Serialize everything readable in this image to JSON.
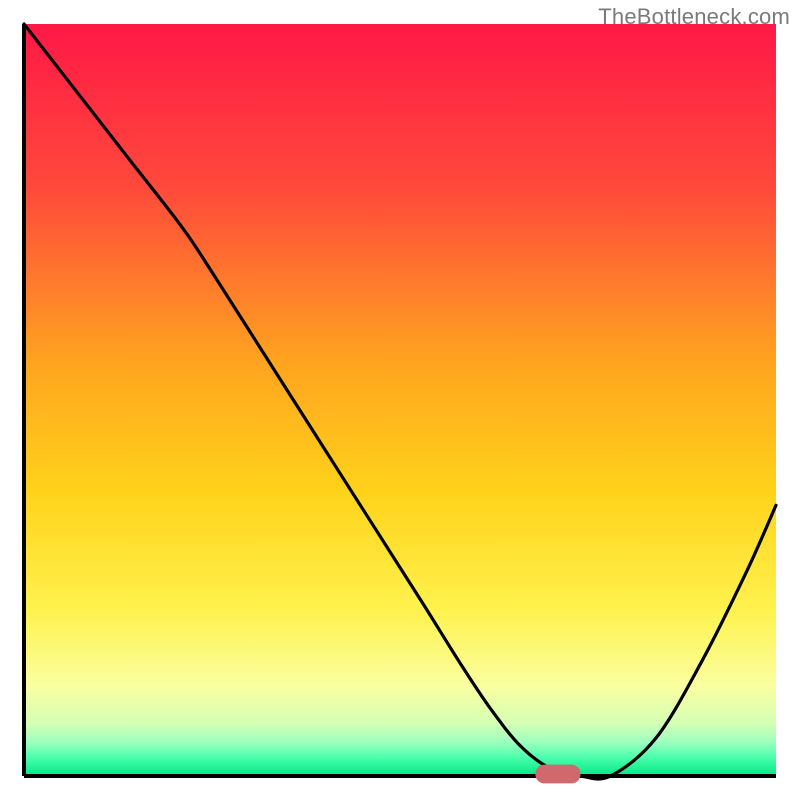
{
  "watermark": "TheBottleneck.com",
  "chart_data": {
    "type": "line",
    "title": "",
    "xlabel": "",
    "ylabel": "",
    "xlim": [
      0,
      100
    ],
    "ylim": [
      0,
      100
    ],
    "grid": false,
    "legend": false,
    "gradient_stops": [
      {
        "offset": 0.0,
        "color": "#ff1846"
      },
      {
        "offset": 0.22,
        "color": "#ff4a3b"
      },
      {
        "offset": 0.45,
        "color": "#ffa41f"
      },
      {
        "offset": 0.62,
        "color": "#ffd21a"
      },
      {
        "offset": 0.78,
        "color": "#fff24e"
      },
      {
        "offset": 0.88,
        "color": "#faffa0"
      },
      {
        "offset": 0.93,
        "color": "#d4ffb4"
      },
      {
        "offset": 0.955,
        "color": "#9dffbf"
      },
      {
        "offset": 0.975,
        "color": "#4dffad"
      },
      {
        "offset": 1.0,
        "color": "#00e884"
      }
    ],
    "series": [
      {
        "name": "bottleneck-curve",
        "color": "#000000",
        "x": [
          0,
          7,
          14,
          21,
          25,
          32,
          39,
          46,
          53,
          58,
          62,
          66,
          70,
          74,
          78,
          84,
          90,
          96,
          100
        ],
        "y": [
          100,
          91,
          82,
          73,
          67,
          56,
          45,
          34,
          23,
          15,
          9,
          4,
          1,
          0,
          0,
          5,
          15,
          27,
          36
        ]
      }
    ],
    "marker": {
      "name": "optimum-marker",
      "x_center": 71,
      "y": 0,
      "width_pct": 6,
      "height_pct": 2.5,
      "color": "#d0696e"
    },
    "axes": {
      "left": {
        "x": 3,
        "y0": 3,
        "y1": 97
      },
      "bottom": {
        "y": 97,
        "x0": 3,
        "x1": 97
      }
    }
  }
}
